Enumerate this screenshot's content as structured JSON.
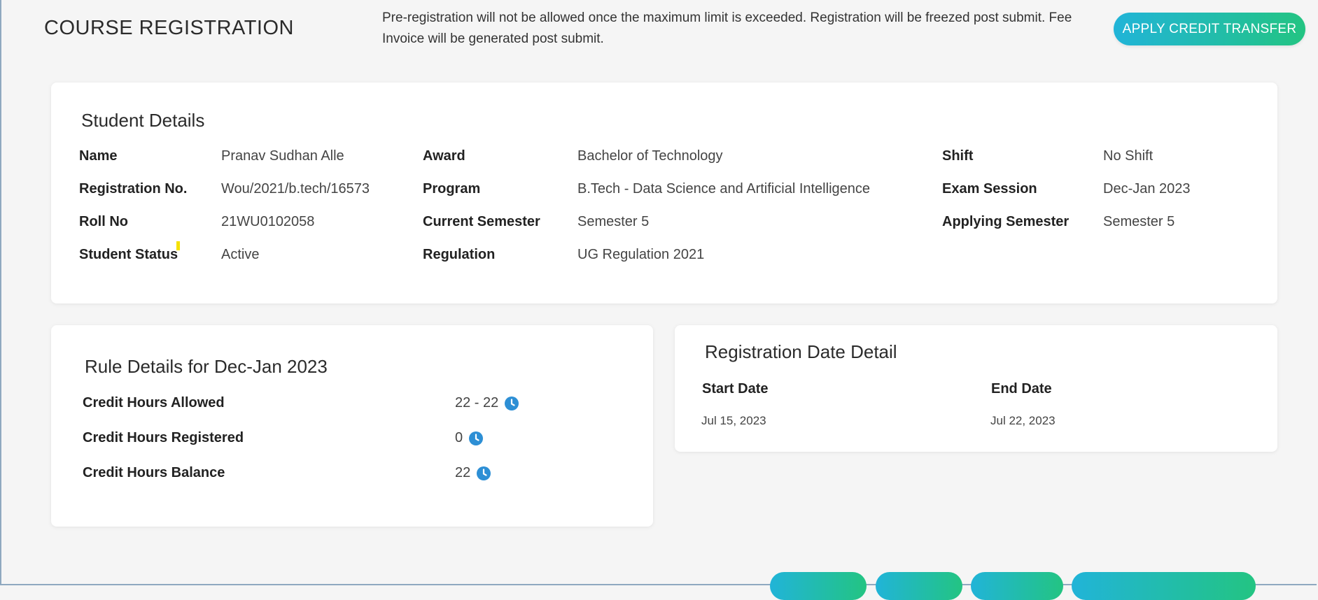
{
  "header": {
    "title": "COURSE REGISTRATION",
    "notice": "Pre-registration will not be allowed once the maximum limit is exceeded. Registration will be freezed post submit. Fee Invoice will be generated post submit.",
    "credit_transfer_label": "APPLY CREDIT TRANSFER"
  },
  "student": {
    "title": "Student Details",
    "name_label": "Name",
    "name": "Pranav Sudhan Alle",
    "reg_label": "Registration No.",
    "reg": "Wou/2021/b.tech/16573",
    "roll_label": "Roll No",
    "roll": "21WU0102058",
    "status_label": "Student Status",
    "status": "Active",
    "award_label": "Award",
    "award": "Bachelor of Technology",
    "program_label": "Program",
    "program": "B.Tech - Data Science and Artificial Intelligence",
    "current_sem_label": "Current Semester",
    "current_sem": "Semester 5",
    "regulation_label": "Regulation",
    "regulation": "UG Regulation 2021",
    "shift_label": "Shift",
    "shift": "No Shift",
    "exam_session_label": "Exam Session",
    "exam_session": "Dec-Jan 2023",
    "applying_sem_label": "Applying Semester",
    "applying_sem": "Semester 5"
  },
  "rules": {
    "title": "Rule Details for Dec-Jan 2023",
    "rows": [
      {
        "label": "Credit Hours Allowed",
        "value": "22 - 22",
        "icon": "clock-icon"
      },
      {
        "label": "Credit Hours Registered",
        "value": "0",
        "icon": "clock-icon"
      },
      {
        "label": "Credit Hours Balance",
        "value": "22",
        "icon": "clock-icon"
      }
    ]
  },
  "dates": {
    "title": "Registration Date Detail",
    "start_label": "Start Date",
    "start": "Jul 15, 2023",
    "end_label": "End Date",
    "end": "Jul 22, 2023"
  },
  "colors": {
    "accent_start": "#21b4d8",
    "accent_end": "#23c482",
    "icon_blue": "#2d8fd5"
  }
}
